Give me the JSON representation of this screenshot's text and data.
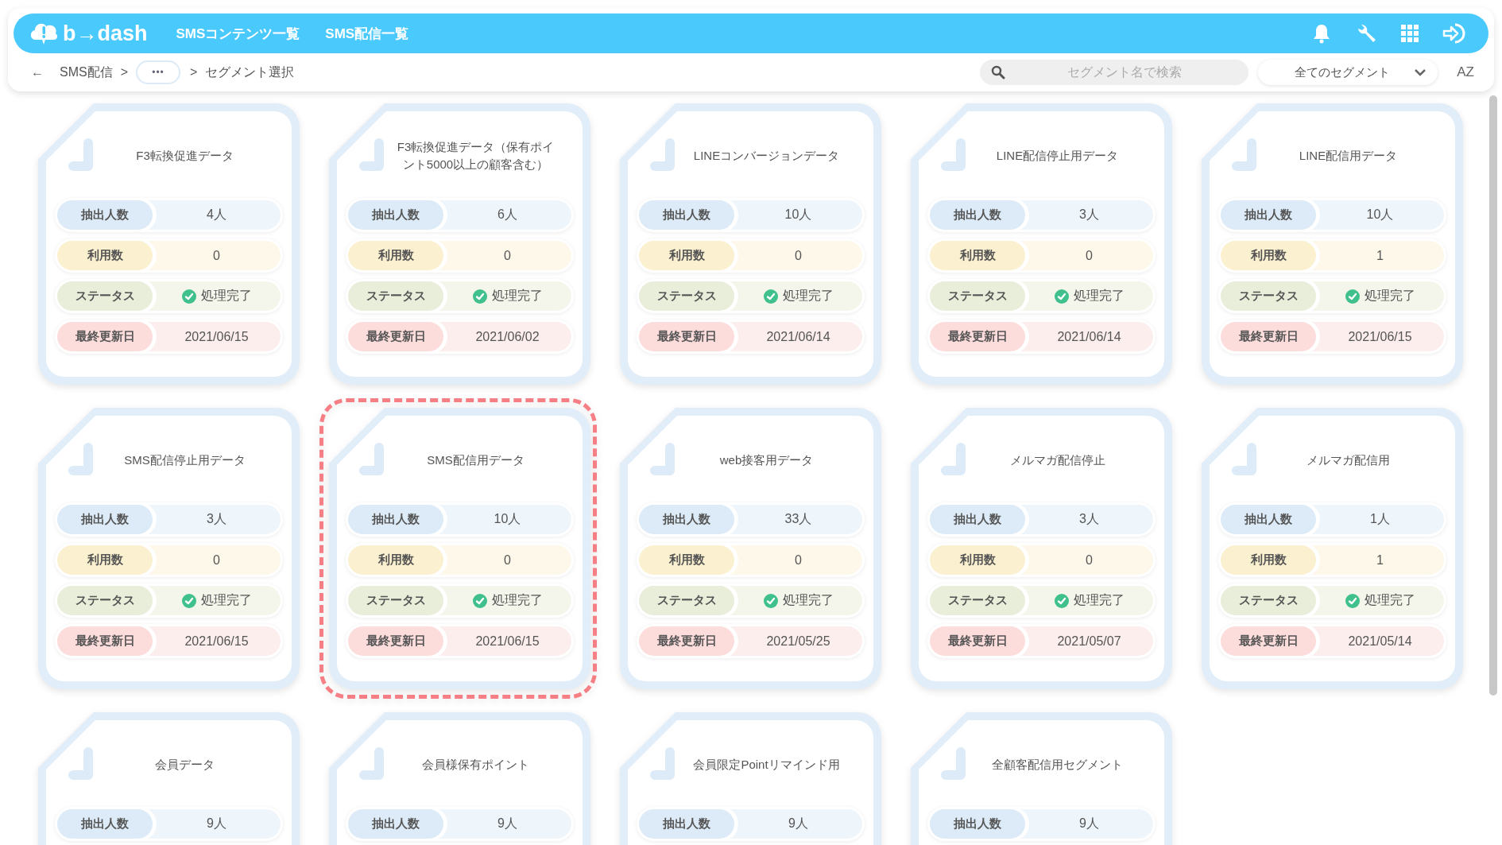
{
  "header": {
    "logo": "b→dash",
    "nav": [
      {
        "label": "SMSコンテンツ一覧"
      },
      {
        "label": "SMS配信一覧"
      }
    ]
  },
  "breadcrumb": {
    "back": "←",
    "items": [
      {
        "kind": "link",
        "text": "SMS配信"
      },
      {
        "kind": "sep",
        "text": ">"
      },
      {
        "kind": "more",
        "text": "•••"
      },
      {
        "kind": "sep",
        "text": ">"
      },
      {
        "kind": "current",
        "text": "セグメント選択"
      }
    ]
  },
  "search": {
    "placeholder": "セグメント名で検索"
  },
  "filter": {
    "value": "全てのセグメント"
  },
  "sort": {
    "label": "AZ"
  },
  "cards": [
    {
      "title": "F3転換促進データ",
      "selected": false,
      "rows": [
        {
          "kind": "count",
          "label": "抽出人数",
          "value": "4人"
        },
        {
          "kind": "usage",
          "label": "利用数",
          "value": "0"
        },
        {
          "kind": "status",
          "label": "ステータス",
          "value": "処理完了"
        },
        {
          "kind": "date",
          "label": "最終更新日",
          "value": "2021/06/15"
        }
      ]
    },
    {
      "title": "F3転換促進データ（保有ポイント5000以上の顧客含む）",
      "selected": false,
      "rows": [
        {
          "kind": "count",
          "label": "抽出人数",
          "value": "6人"
        },
        {
          "kind": "usage",
          "label": "利用数",
          "value": "0"
        },
        {
          "kind": "status",
          "label": "ステータス",
          "value": "処理完了"
        },
        {
          "kind": "date",
          "label": "最終更新日",
          "value": "2021/06/02"
        }
      ]
    },
    {
      "title": "LINEコンバージョンデータ",
      "selected": false,
      "rows": [
        {
          "kind": "count",
          "label": "抽出人数",
          "value": "10人"
        },
        {
          "kind": "usage",
          "label": "利用数",
          "value": "0"
        },
        {
          "kind": "status",
          "label": "ステータス",
          "value": "処理完了"
        },
        {
          "kind": "date",
          "label": "最終更新日",
          "value": "2021/06/14"
        }
      ]
    },
    {
      "title": "LINE配信停止用データ",
      "selected": false,
      "rows": [
        {
          "kind": "count",
          "label": "抽出人数",
          "value": "3人"
        },
        {
          "kind": "usage",
          "label": "利用数",
          "value": "0"
        },
        {
          "kind": "status",
          "label": "ステータス",
          "value": "処理完了"
        },
        {
          "kind": "date",
          "label": "最終更新日",
          "value": "2021/06/14"
        }
      ]
    },
    {
      "title": "LINE配信用データ",
      "selected": false,
      "rows": [
        {
          "kind": "count",
          "label": "抽出人数",
          "value": "10人"
        },
        {
          "kind": "usage",
          "label": "利用数",
          "value": "1"
        },
        {
          "kind": "status",
          "label": "ステータス",
          "value": "処理完了"
        },
        {
          "kind": "date",
          "label": "最終更新日",
          "value": "2021/06/15"
        }
      ]
    },
    {
      "title": "SMS配信停止用データ",
      "selected": false,
      "rows": [
        {
          "kind": "count",
          "label": "抽出人数",
          "value": "3人"
        },
        {
          "kind": "usage",
          "label": "利用数",
          "value": "0"
        },
        {
          "kind": "status",
          "label": "ステータス",
          "value": "処理完了"
        },
        {
          "kind": "date",
          "label": "最終更新日",
          "value": "2021/06/15"
        }
      ]
    },
    {
      "title": "SMS配信用データ",
      "selected": true,
      "rows": [
        {
          "kind": "count",
          "label": "抽出人数",
          "value": "10人"
        },
        {
          "kind": "usage",
          "label": "利用数",
          "value": "0"
        },
        {
          "kind": "status",
          "label": "ステータス",
          "value": "処理完了"
        },
        {
          "kind": "date",
          "label": "最終更新日",
          "value": "2021/06/15"
        }
      ]
    },
    {
      "title": "web接客用データ",
      "selected": false,
      "rows": [
        {
          "kind": "count",
          "label": "抽出人数",
          "value": "33人"
        },
        {
          "kind": "usage",
          "label": "利用数",
          "value": "0"
        },
        {
          "kind": "status",
          "label": "ステータス",
          "value": "処理完了"
        },
        {
          "kind": "date",
          "label": "最終更新日",
          "value": "2021/05/25"
        }
      ]
    },
    {
      "title": "メルマガ配信停止",
      "selected": false,
      "rows": [
        {
          "kind": "count",
          "label": "抽出人数",
          "value": "3人"
        },
        {
          "kind": "usage",
          "label": "利用数",
          "value": "0"
        },
        {
          "kind": "status",
          "label": "ステータス",
          "value": "処理完了"
        },
        {
          "kind": "date",
          "label": "最終更新日",
          "value": "2021/05/07"
        }
      ]
    },
    {
      "title": "メルマガ配信用",
      "selected": false,
      "rows": [
        {
          "kind": "count",
          "label": "抽出人数",
          "value": "1人"
        },
        {
          "kind": "usage",
          "label": "利用数",
          "value": "1"
        },
        {
          "kind": "status",
          "label": "ステータス",
          "value": "処理完了"
        },
        {
          "kind": "date",
          "label": "最終更新日",
          "value": "2021/05/14"
        }
      ]
    },
    {
      "title": "会員データ",
      "selected": false,
      "rows": [
        {
          "kind": "count",
          "label": "抽出人数",
          "value": "9人"
        }
      ]
    },
    {
      "title": "会員様保有ポイント",
      "selected": false,
      "rows": [
        {
          "kind": "count",
          "label": "抽出人数",
          "value": "9人"
        }
      ]
    },
    {
      "title": "会員限定Pointリマインド用",
      "selected": false,
      "rows": [
        {
          "kind": "count",
          "label": "抽出人数",
          "value": "9人"
        }
      ]
    },
    {
      "title": "全顧客配信用セグメント",
      "selected": false,
      "rows": [
        {
          "kind": "count",
          "label": "抽出人数",
          "value": "9人"
        }
      ]
    }
  ]
}
